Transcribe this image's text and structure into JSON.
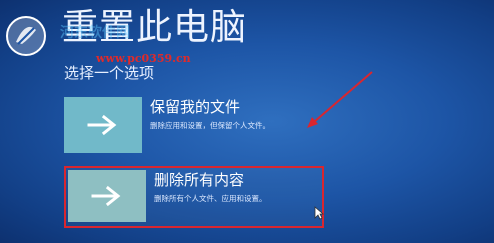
{
  "header": {
    "title": "重置此电脑",
    "subtitle": "选择一个选项"
  },
  "options": [
    {
      "label": "保留我的文件",
      "description": "删除应用和设置，但保留个人文件。",
      "icon": "arrow-right-icon"
    },
    {
      "label": "删除所有内容",
      "description": "删除所有个人文件、应用和设置。",
      "icon": "arrow-right-icon",
      "highlighted": true
    }
  ],
  "watermark": {
    "text": "www.pc0359.cn",
    "overlay_text": "河东软件网",
    "logo": "pc0359-logo"
  },
  "colors": {
    "background": "#1d55a6",
    "tile_keep": "#71b9c9",
    "tile_remove": "#8ebfc2",
    "highlight_border": "#d9262f",
    "annotation_arrow": "#d9262f",
    "watermark_text": "#e02a2a"
  }
}
